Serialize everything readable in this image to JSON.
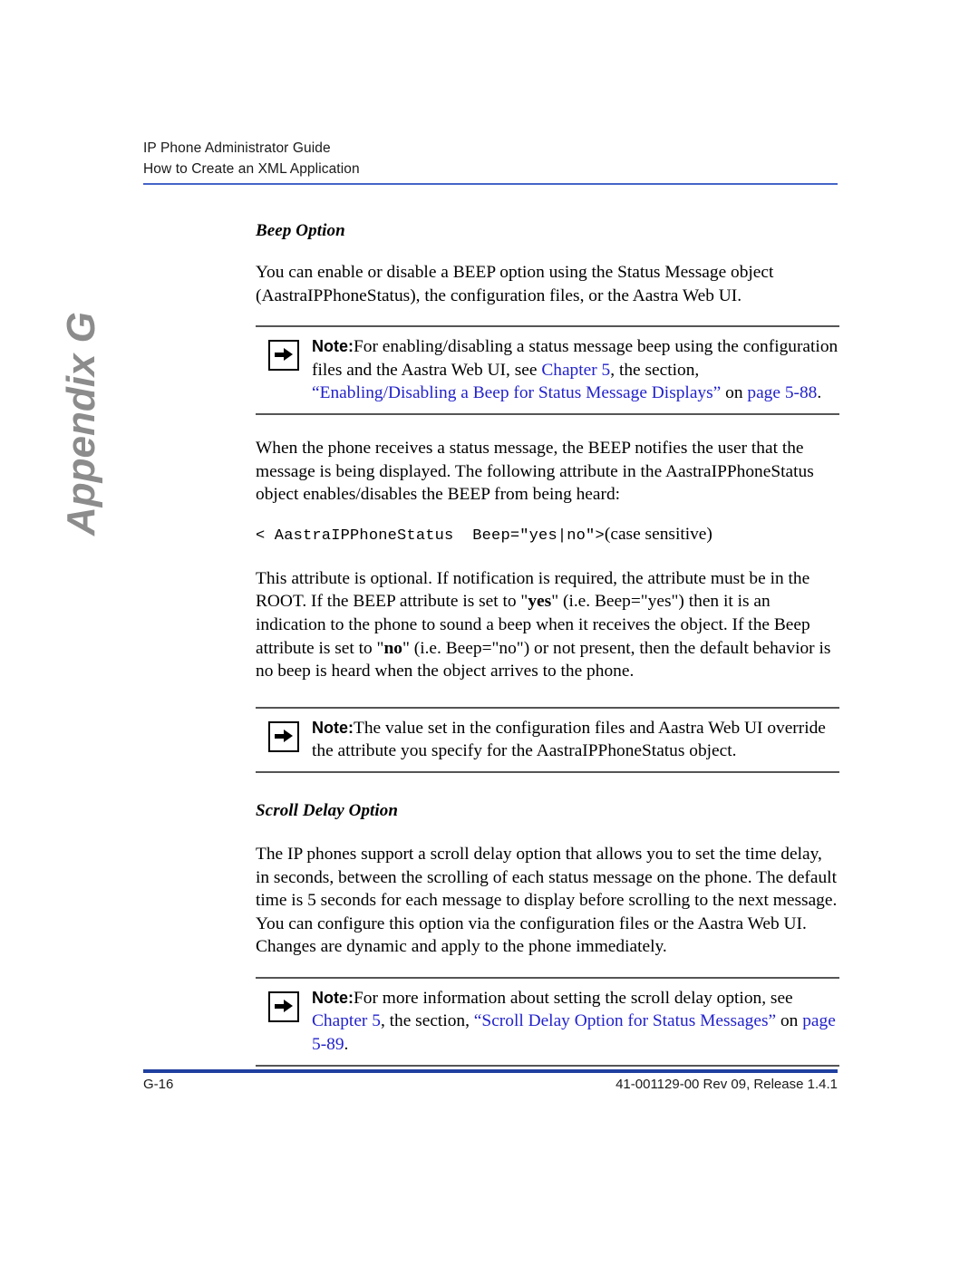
{
  "header": {
    "line1": "IP Phone Administrator Guide",
    "line2": "How to Create an XML Application",
    "rule_color": "#4464c8"
  },
  "appendix_tab": {
    "label": "Appendix G",
    "color": "#8c8c8c"
  },
  "sections": {
    "beep_option": {
      "heading": "Beep Option",
      "intro": "You can enable or disable a BEEP option using the Status Message object (AastraIPPhoneStatus), the configuration files, or the Aastra Web UI.",
      "note1": {
        "label": "Note:",
        "text_part1": "For enabling/disabling a status message beep using the configuration files and the Aastra Web UI, see ",
        "link1": "Chapter 5",
        "text_part2": ", the section, ",
        "link2": "“Enabling/Disabling a Beep for Status Message Displays”",
        "text_part3": " on ",
        "link3": "page 5-88",
        "text_part4": "."
      },
      "paragraph2": "When the phone receives a status message, the BEEP notifies the user that the message is being displayed. The following attribute in the AastraIPPhoneStatus object enables/disables the BEEP from being heard:",
      "code": "< AastraIPPhoneStatus  Beep=\"yes|no\">",
      "code_caption": "(case sensitive)",
      "paragraph3_a": "This attribute is optional. If notification is required, the attribute must be in the ROOT. If the BEEP attribute is set to \"",
      "paragraph3_yes": "yes",
      "paragraph3_b": "\" (i.e. Beep=\"yes\") then it is an indication to the phone to sound a beep when it receives the object.  If the Beep attribute is set to \"",
      "paragraph3_no": "no",
      "paragraph3_c": "\" (i.e. Beep=\"no\") or not present, then the default behavior is no beep is heard when the object arrives to the phone.",
      "note2": {
        "label": "Note:",
        "text": "The value set in the configuration files and Aastra Web UI override the attribute you specify for the AastraIPPhoneStatus object."
      }
    },
    "scroll_delay_option": {
      "heading": "Scroll Delay Option",
      "paragraph1": "The IP phones support a scroll delay option that allows you to set the time delay, in seconds, between the scrolling of each status message on the phone. The default time is 5 seconds for each message to display before scrolling to the next message. You can configure this option via the configuration files or the Aastra Web UI. Changes are dynamic and apply to the phone immediately.",
      "note3": {
        "label": "Note:",
        "text_part1": "For more information about setting the scroll delay option, see ",
        "link1": "Chapter 5",
        "text_part2": ", the section, ",
        "link2": "“Scroll Delay Option for Status Messages”",
        "text_part3": " on ",
        "link3": "page 5-89",
        "text_part4": "."
      }
    }
  },
  "footer": {
    "page_number": "G-16",
    "doc_id": "41-001129-00 Rev 09, Release 1.4.1",
    "rule_color": "#1f3f9f"
  },
  "colors": {
    "link": "#2222cc",
    "note_rule": "#555555",
    "text": "#000000"
  }
}
